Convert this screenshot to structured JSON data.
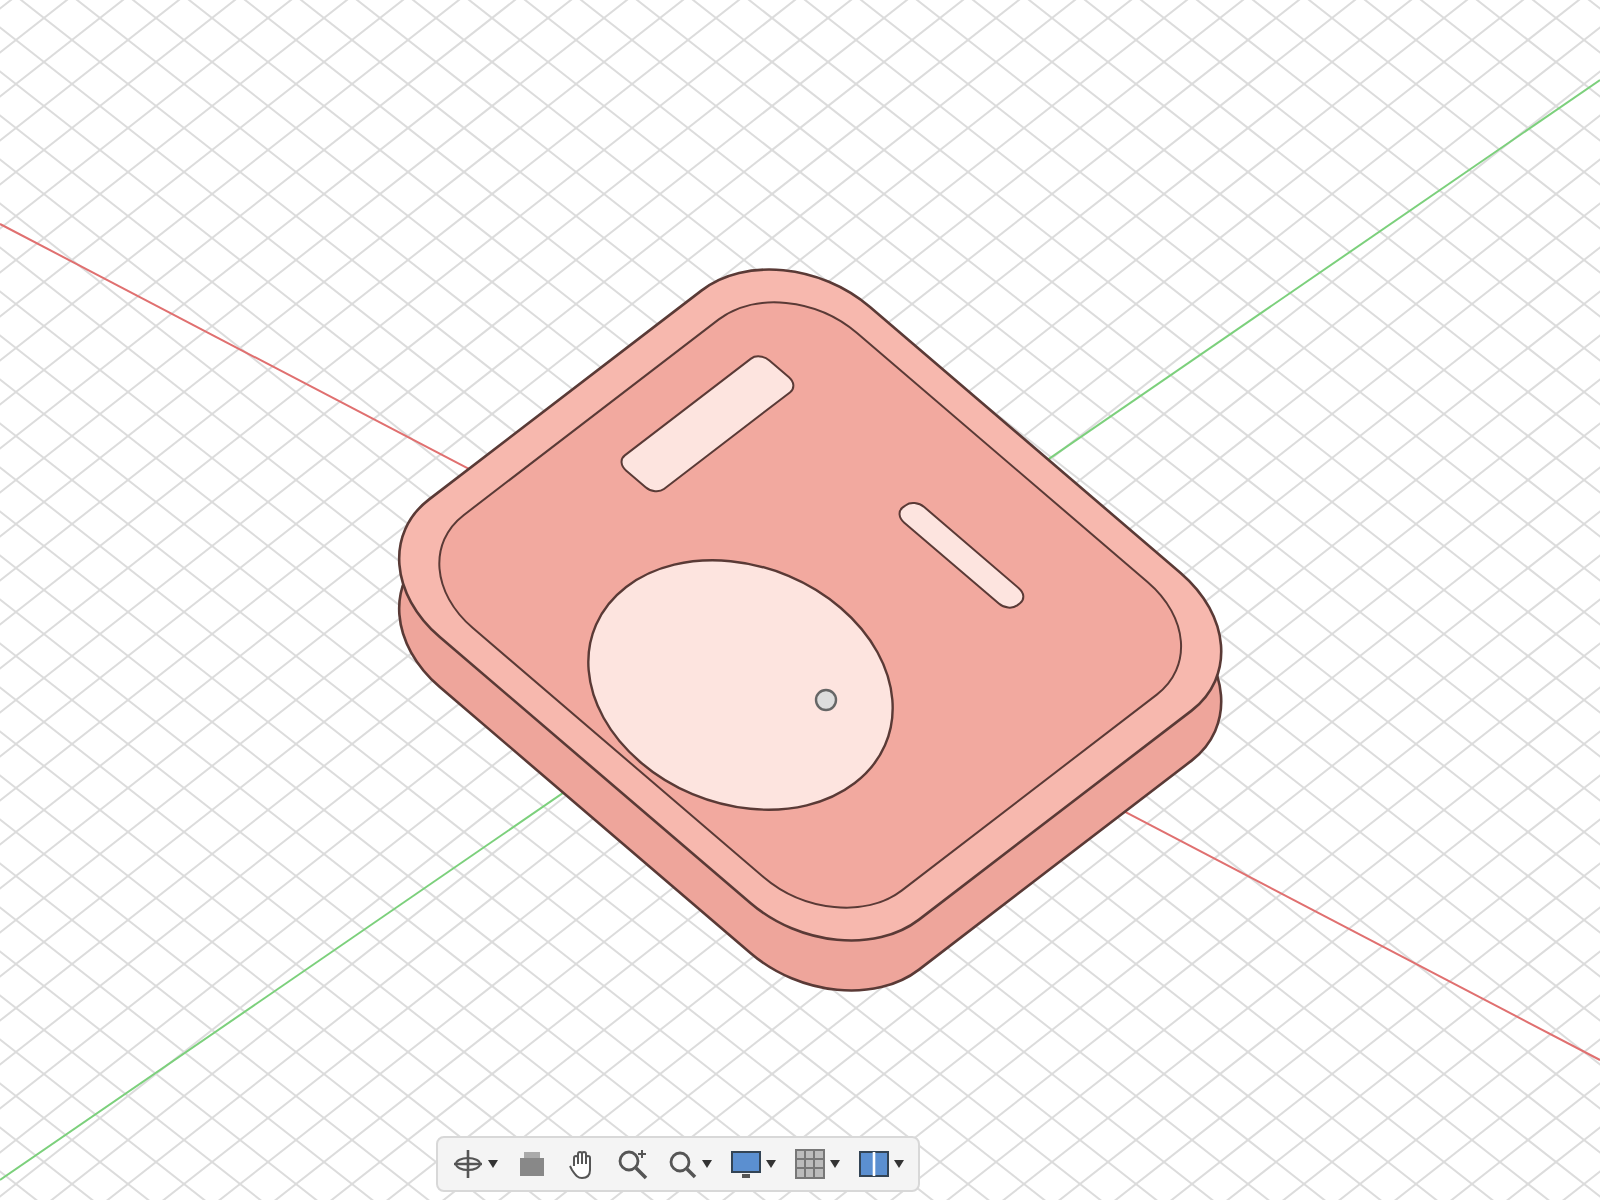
{
  "toolbar": {
    "tools": [
      {
        "kind": "orbit",
        "dropdown": true
      },
      {
        "kind": "look",
        "dropdown": false
      },
      {
        "kind": "pan",
        "dropdown": false
      },
      {
        "kind": "zoom_window",
        "dropdown": false
      },
      {
        "kind": "zoom",
        "dropdown": true
      },
      {
        "kind": "display",
        "dropdown": true
      },
      {
        "kind": "grid",
        "dropdown": true
      },
      {
        "kind": "viewports",
        "dropdown": true
      }
    ]
  }
}
